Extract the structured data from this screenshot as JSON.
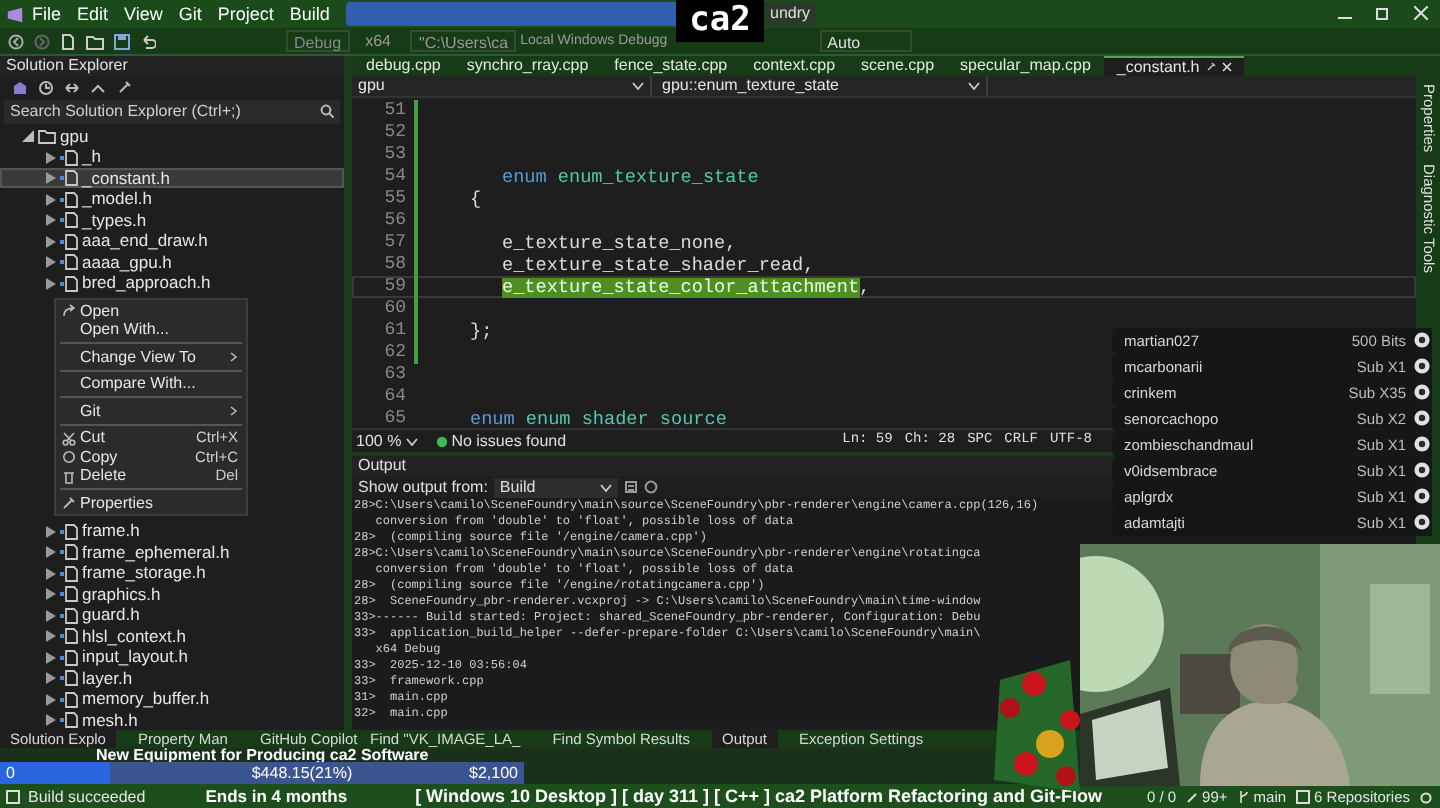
{
  "menu_bar": {
    "items": [
      "File",
      "Edit",
      "View",
      "Git",
      "Project",
      "Build"
    ],
    "logo": "ca2",
    "solution_name": "undry"
  },
  "toolbar": {
    "configuration": "Debug",
    "platform": "x64",
    "startup_path": "\"C:\\Users\\ca",
    "debugger": "Local Windows Debugg",
    "mode": "Auto"
  },
  "solution_explorer": {
    "title": "Solution Explorer",
    "search": {
      "placeholder": "Search Solution Explorer (Ctrl+;)"
    },
    "tree": [
      {
        "label": "gpu",
        "expanded": true,
        "children": [
          {
            "label": "_h",
            "selected": false
          },
          {
            "label": "_constant.h",
            "selected": true
          },
          {
            "label": "_model.h",
            "selected": false
          },
          {
            "label": "_types.h",
            "selected": false
          },
          {
            "label": "aaa_end_draw.h",
            "selected": false
          },
          {
            "label": "aaaa_gpu.h",
            "selected": false
          },
          {
            "label": "bred_approach.h",
            "selected": false
          },
          {
            "label": "frame.h",
            "selected": false
          },
          {
            "label": "frame_ephemeral.h",
            "selected": false
          },
          {
            "label": "frame_storage.h",
            "selected": false
          },
          {
            "label": "graphics.h",
            "selected": false
          },
          {
            "label": "guard.h",
            "selected": false
          },
          {
            "label": "hlsl_context.h",
            "selected": false
          },
          {
            "label": "input_layout.h",
            "selected": false
          },
          {
            "label": "layer.h",
            "selected": false
          },
          {
            "label": "memory_buffer.h",
            "selected": false
          },
          {
            "label": "mesh.h",
            "selected": false
          }
        ]
      }
    ],
    "context_menu": [
      {
        "label": "Open"
      },
      {
        "label": "Open With..."
      },
      {
        "label": "Change View To",
        "submenu": true,
        "separator_before": true
      },
      {
        "label": "Compare With...",
        "separator_before": true
      },
      {
        "label": "Git",
        "submenu": true,
        "separator_before": true
      },
      {
        "label": "Cut",
        "shortcut": "Ctrl+X",
        "separator_before": true
      },
      {
        "label": "Copy",
        "shortcut": "Ctrl+C"
      },
      {
        "label": "Delete",
        "shortcut": "Del"
      },
      {
        "label": "Properties",
        "separator_before": true
      }
    ]
  },
  "editor": {
    "tabs": [
      {
        "label": "debug.cpp",
        "selected": false
      },
      {
        "label": "synchro_rray.cpp",
        "selected": false
      },
      {
        "label": "fence_state.cpp",
        "selected": false
      },
      {
        "label": "context.cpp",
        "selected": false
      },
      {
        "label": "scene.cpp",
        "selected": false
      },
      {
        "label": "specular_map.cpp",
        "selected": false
      },
      {
        "label": "_constant.h",
        "selected": true
      }
    ],
    "navigation": {
      "scope": "gpu",
      "symbol": "gpu::enum_texture_state"
    },
    "lines": [
      {
        "number": "51"
      },
      {
        "number": "52"
      },
      {
        "number": "53"
      },
      {
        "number": "54",
        "indented": true,
        "tokens": [
          {
            "kind": "keyword",
            "text": "enum"
          },
          {
            "kind": "type",
            "text": "enum_texture_state"
          }
        ]
      },
      {
        "number": "55",
        "tokens": [
          {
            "kind": "plain",
            "text": "{"
          }
        ]
      },
      {
        "number": "56"
      },
      {
        "number": "57",
        "indented": true,
        "tokens": [
          {
            "kind": "plain",
            "text": "e_texture_state_none,"
          }
        ]
      },
      {
        "number": "58",
        "indented": true,
        "tokens": [
          {
            "kind": "plain",
            "text": "e_texture_state_shader_read,"
          }
        ]
      },
      {
        "number": "59",
        "current": true,
        "indented": true,
        "tokens": [
          {
            "kind": "highlight",
            "text": "e_texture_state_color_attachment"
          },
          {
            "kind": "plain",
            "text": ","
          }
        ]
      },
      {
        "number": "60"
      },
      {
        "number": "61",
        "tokens": [
          {
            "kind": "plain",
            "text": "};"
          }
        ]
      },
      {
        "number": "62"
      },
      {
        "number": "63"
      },
      {
        "number": "64"
      },
      {
        "number": "65",
        "tokens": [
          {
            "kind": "keyword",
            "text": "enum"
          },
          {
            "kind": "type",
            "text": "enum"
          },
          {
            "kind": "type",
            "text": "shader"
          },
          {
            "kind": "type",
            "text": "source"
          }
        ]
      }
    ],
    "status": {
      "zoom": "100 %",
      "issues": "No issues found",
      "line": "Ln: 59",
      "column": "Ch: 28",
      "indentation": "SPC",
      "line_endings": "CRLF",
      "encoding": "UTF-8"
    }
  },
  "output": {
    "title": "Output",
    "source_label": "Show output from:",
    "source": "Build",
    "lines": [
      "28>C:\\Users\\camilo\\SceneFoundry\\main\\source\\SceneFoundry\\pbr-renderer\\engine\\camera.cpp(126,16)",
      "   conversion from 'double' to 'float', possible loss of data",
      "28>  (compiling source file '/engine/camera.cpp')",
      "28>C:\\Users\\camilo\\SceneFoundry\\main\\source\\SceneFoundry\\pbr-renderer\\engine\\rotatingca",
      "   conversion from 'double' to 'float', possible loss of data",
      "28>  (compiling source file '/engine/rotatingcamera.cpp')",
      "28>  SceneFoundry_pbr-renderer.vcxproj -> C:\\Users\\camilo\\SceneFoundry\\main\\time-window",
      "33>------ Build started: Project: shared_SceneFoundry_pbr-renderer, Configuration: Debu",
      "33>  application_build_helper --defer-prepare-folder C:\\Users\\camilo\\SceneFoundry\\main\\",
      "   x64 Debug",
      "33>  2025-12-10 03:56:04",
      "33>  framework.cpp",
      "31>  main.cpp",
      "32>  main.cpp"
    ]
  },
  "side_panel_tabs": [
    "Properties",
    "Diagnostic Tools"
  ],
  "bottom_tabs": {
    "left": [
      {
        "label": "Solution Explo",
        "selected": true
      },
      {
        "label": "Property Man",
        "selected": false
      },
      {
        "label": "GitHub Copilot",
        "selected": false
      }
    ],
    "right": [
      {
        "label": "Find \"VK_IMAGE_LA_",
        "selected": false
      },
      {
        "label": "Find Symbol Results",
        "selected": false
      },
      {
        "label": "Output",
        "selected": true
      },
      {
        "label": "Exception Settings",
        "selected": false
      }
    ]
  },
  "stream_overlay": {
    "goal": {
      "title": "New Equipment for Producing ca2 Software",
      "start": "0",
      "raised": "$448.15(21%)",
      "target": "$2,100",
      "level": 0.21
    },
    "timer": "Ends in 4 months",
    "stream_title": "[ Windows 10 Desktop ] [ day 311 ] [ C++ ] ca2 Platform Refactoring and Git-Flow",
    "supporters": [
      {
        "name": "martian027",
        "amount": "500 Bits"
      },
      {
        "name": "mcarbonarii",
        "amount": "Sub X1"
      },
      {
        "name": "crinkem",
        "amount": "Sub X35"
      },
      {
        "name": "senorcachopo",
        "amount": "Sub X2"
      },
      {
        "name": "zombieschandmaul",
        "amount": "Sub X1"
      },
      {
        "name": "v0idsembrace",
        "amount": "Sub X1"
      },
      {
        "name": "aplgrdx",
        "amount": "Sub X1"
      },
      {
        "name": "adamtajti",
        "amount": "Sub X1"
      }
    ]
  },
  "status_bar": {
    "message": "Build succeeded",
    "sync": "0 / 0",
    "changes": "99+",
    "branch": "main",
    "repositories": "6 Repositories"
  }
}
